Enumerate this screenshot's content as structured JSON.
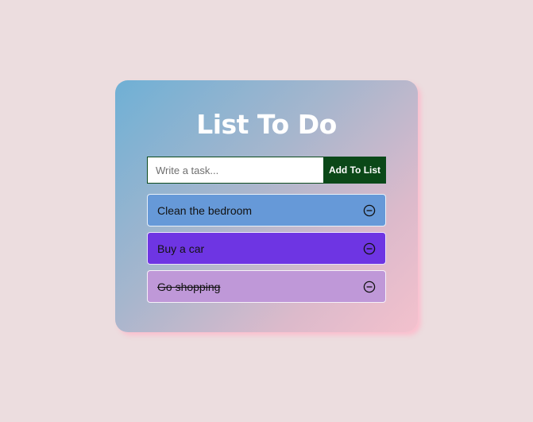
{
  "app": {
    "title": "List To Do"
  },
  "form": {
    "placeholder": "Write a task...",
    "value": "",
    "add_label": "Add To List"
  },
  "tasks": [
    {
      "label": "Clean the bedroom",
      "completed": false,
      "color": "#6699d8",
      "icon": "minus-circle-icon"
    },
    {
      "label": "Buy a car",
      "completed": false,
      "color": "#6e35e3",
      "icon": "minus-circle-icon"
    },
    {
      "label": "Go shopping",
      "completed": true,
      "color": "#bf98d8",
      "icon": "minus-circle-icon"
    }
  ],
  "colors": {
    "background": "#ecdddf",
    "card_gradient_start": "#6fb0d5",
    "card_gradient_end": "#f3c1cd",
    "add_button": "#0b4818"
  }
}
